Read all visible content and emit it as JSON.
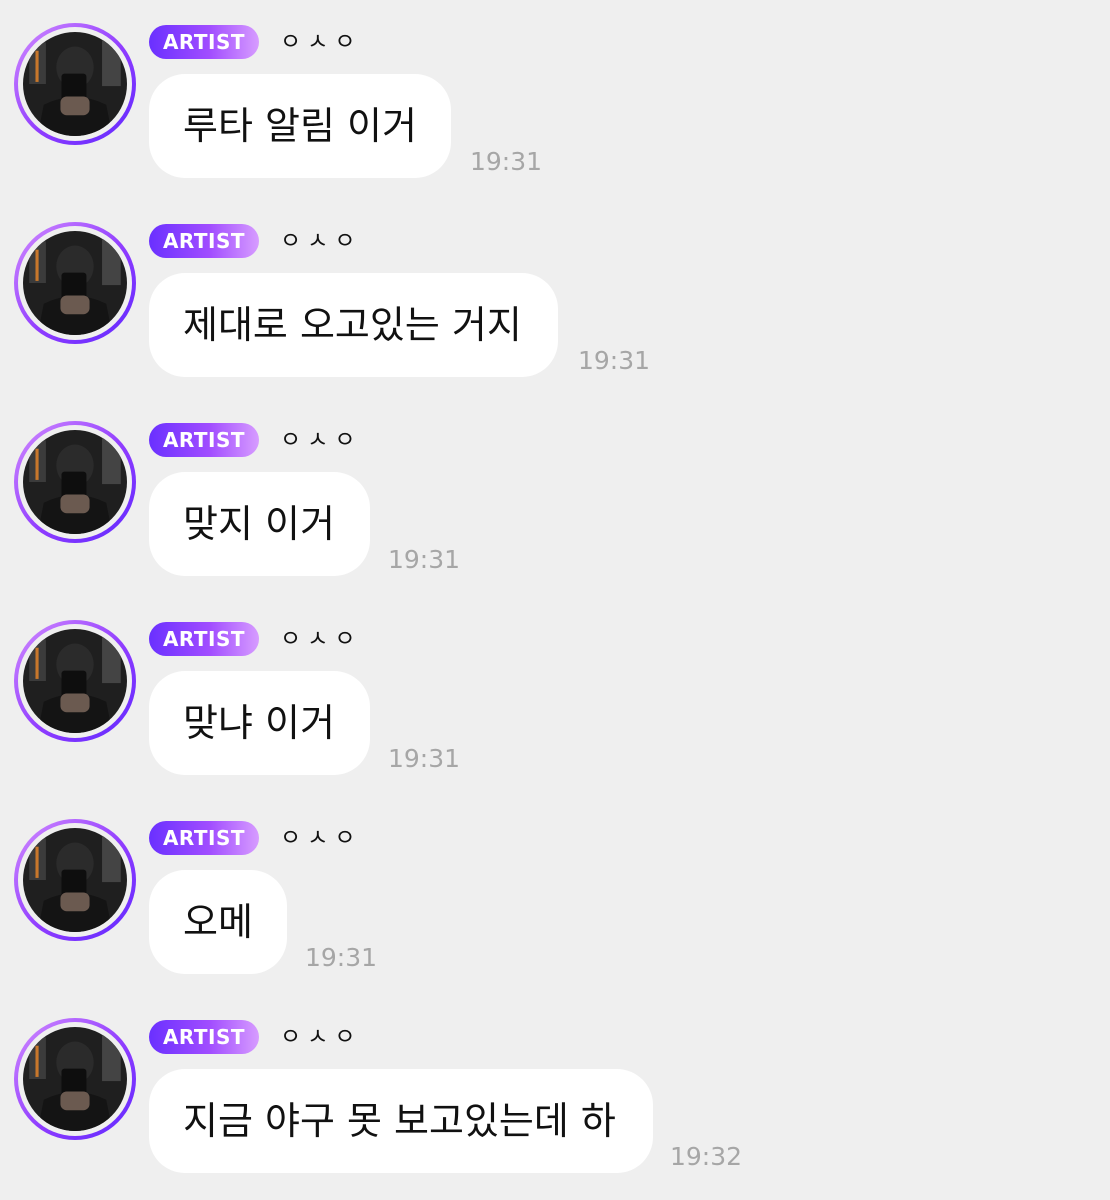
{
  "messages": [
    {
      "badge": "ARTIST",
      "sender": "ㅇㅅㅇ",
      "text": "루타 알림 이거",
      "time": "19:31"
    },
    {
      "badge": "ARTIST",
      "sender": "ㅇㅅㅇ",
      "text": "제대로 오고있는 거지",
      "time": "19:31"
    },
    {
      "badge": "ARTIST",
      "sender": "ㅇㅅㅇ",
      "text": "맞지 이거",
      "time": "19:31"
    },
    {
      "badge": "ARTIST",
      "sender": "ㅇㅅㅇ",
      "text": "맞냐 이거",
      "time": "19:31"
    },
    {
      "badge": "ARTIST",
      "sender": "ㅇㅅㅇ",
      "text": "오메",
      "time": "19:31"
    },
    {
      "badge": "ARTIST",
      "sender": "ㅇㅅㅇ",
      "text": "지금 야구 못 보고있는데 하",
      "time": "19:32"
    }
  ],
  "colors": {
    "background": "#efefef",
    "bubble": "#ffffff",
    "badge_start": "#6a30ff",
    "badge_end": "#d79cff",
    "avatar_ring": "#8f3cff",
    "timestamp": "#a6a6a6",
    "text": "#111111"
  },
  "icons": {
    "avatar": "artist-profile-photo"
  }
}
